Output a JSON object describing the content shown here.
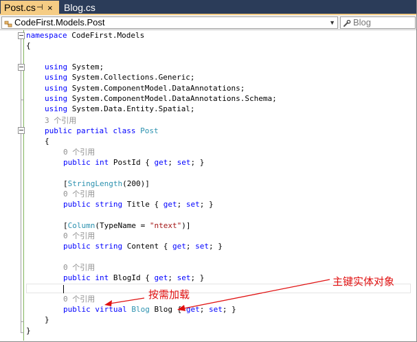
{
  "tabs": [
    {
      "label": "Post.cs",
      "active": true,
      "pin_glyph": "⊣",
      "close_glyph": "×"
    },
    {
      "label": "Blog.cs",
      "active": false
    }
  ],
  "nav": {
    "type_combo": "CodeFirst.Models.Post",
    "member_combo": "Blog"
  },
  "code": {
    "l1": {
      "kw": "namespace",
      "rest": " CodeFirst.Models"
    },
    "l2": "{",
    "using_kw": "using",
    "u1": " System;",
    "u2": " System.Collections.Generic;",
    "u3": " System.ComponentModel.DataAnnotations;",
    "u4": " System.ComponentModel.DataAnnotations.Schema;",
    "u5": " System.Data.Entity.Spatial;",
    "lens_class": "3 个引用",
    "cls": {
      "kw1": "public",
      "kw2": "partial",
      "kw3": "class",
      "name": "Post"
    },
    "open_brace": "{",
    "close_brace": "}",
    "lens_ref": "0 个引用",
    "pub": "public",
    "int_kw": "int",
    "string_kw": "string",
    "virtual_kw": "virtual",
    "get_kw": "get",
    "set_kw": "set",
    "p1_name": " PostId { ",
    "semi_space": "; ",
    "end_prop": "; }",
    "attr1": {
      "open": "[",
      "type": "StringLength",
      "args": "(200)]"
    },
    "p2_name": " Title { ",
    "attr2": {
      "open": "[",
      "type": "Column",
      "mid": "(TypeName = ",
      "str": "\"ntext\"",
      "close": ")]"
    },
    "p3_name": " Content { ",
    "p4_name": " BlogId { ",
    "p5_type": "Blog",
    "p5_name": " Blog { "
  },
  "annotations": {
    "lazy_loading": "按需加载",
    "primary_key_entity": "主键实体对象",
    "color": "#e01010"
  }
}
